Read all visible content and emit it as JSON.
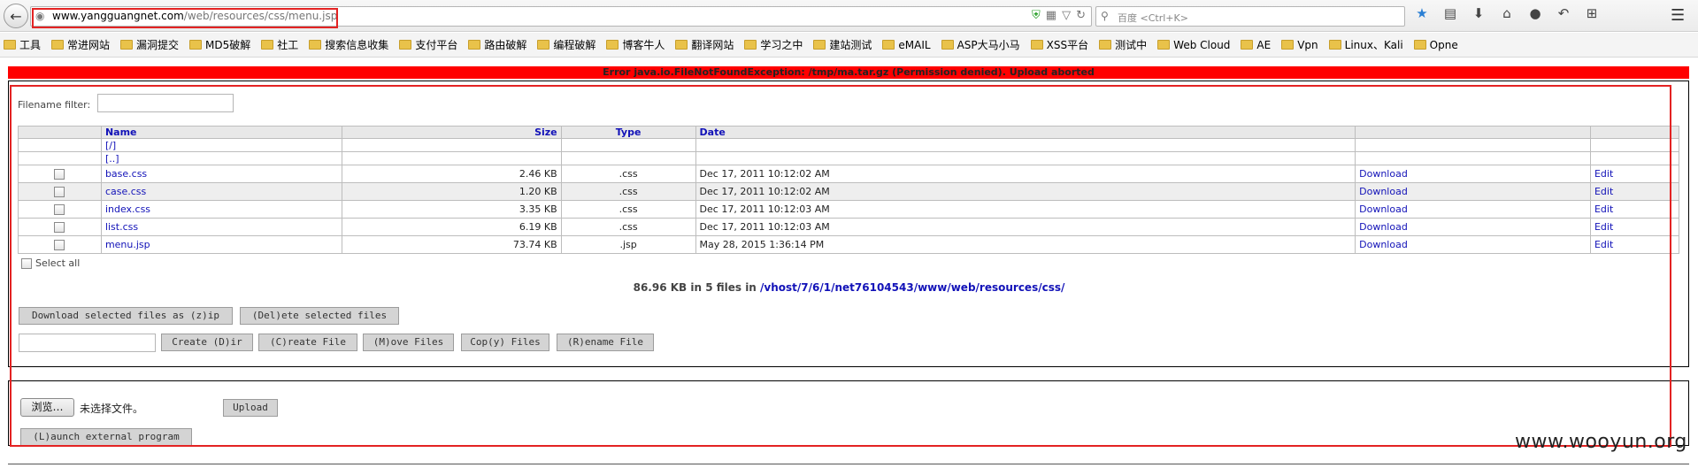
{
  "browser": {
    "url_host": "www.yangguangnet.com",
    "url_path": "/web/resources/css/menu.jsp",
    "search_placeholder": "百度 <Ctrl+K>",
    "bookmarks": [
      "工具",
      "常进网站",
      "漏洞提交",
      "MD5破解",
      "社工",
      "搜索信息收集",
      "支付平台",
      "路由破解",
      "编程破解",
      "博客牛人",
      "翻译网站",
      "学习之中",
      "建站测试",
      "eMAIL",
      "ASP大马小马",
      "XSS平台",
      "测试中",
      "Web Cloud",
      "AE",
      "Vpn",
      "Linux、Kali",
      "Opne"
    ]
  },
  "error": "Error java.io.FileNotFoundException: /tmp/ma.tar.gz (Permission denied). Upload aborted",
  "filter": {
    "label": "Filename filter:",
    "value": ""
  },
  "table": {
    "headers": {
      "name": "Name",
      "size": "Size",
      "type": "Type",
      "date": "Date"
    },
    "root_link": "[/]",
    "parent_link": "[..]",
    "rows": [
      {
        "name": "base.css",
        "size": "2.46 KB",
        "type": ".css",
        "date": "Dec 17, 2011 10:12:02 AM",
        "download": "Download",
        "edit": "Edit"
      },
      {
        "name": "case.css",
        "size": "1.20 KB",
        "type": ".css",
        "date": "Dec 17, 2011 10:12:02 AM",
        "download": "Download",
        "edit": "Edit"
      },
      {
        "name": "index.css",
        "size": "3.35 KB",
        "type": ".css",
        "date": "Dec 17, 2011 10:12:03 AM",
        "download": "Download",
        "edit": "Edit"
      },
      {
        "name": "list.css",
        "size": "6.19 KB",
        "type": ".css",
        "date": "Dec 17, 2011 10:12:03 AM",
        "download": "Download",
        "edit": "Edit"
      },
      {
        "name": "menu.jsp",
        "size": "73.74 KB",
        "type": ".jsp",
        "date": "May 28, 2015 1:36:14 PM",
        "download": "Download",
        "edit": "Edit"
      }
    ]
  },
  "select_all": "Select all",
  "summary": {
    "text": "86.96 KB in 5 files in ",
    "path": "/vhost/7/6/1/net76104543/www/web/resources/css/"
  },
  "buttons": {
    "download_zip": "Download selected files as (z)ip",
    "delete": "(Del)ete selected files",
    "create_dir": "Create (D)ir",
    "create_file": "(C)reate File",
    "move": "(M)ove Files",
    "copy": "Cop(y) Files",
    "rename": "(R)ename File",
    "browse": "浏览…",
    "no_file": "未选择文件。",
    "upload": "Upload",
    "launch": "(L)aunch external program"
  },
  "watermark": "www.wooyun.org",
  "colors": {
    "error_bg": "#ff0000",
    "highlight": "#e32323",
    "link": "#1212b8"
  }
}
